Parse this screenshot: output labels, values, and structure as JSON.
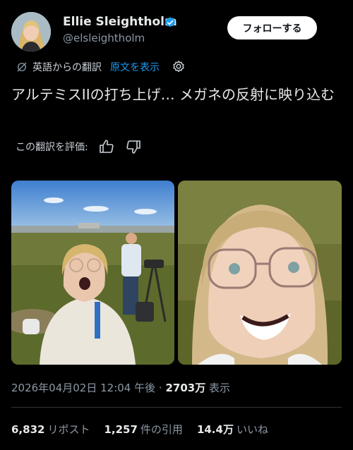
{
  "author": {
    "name": "Ellie Sleightholm",
    "handle": "@elsleightholm",
    "follow_label": "フォローする"
  },
  "translation": {
    "label": "英語からの翻訳",
    "show_original": "原文を表示",
    "rate_label": "この翻訳を評価:"
  },
  "tweet": {
    "text": "アルテミスIIの打ち上げ… メガネの反射に映り込む"
  },
  "meta": {
    "datetime": "2026年04月02日 12:04 午後",
    "views_count": "2703万",
    "views_label": "表示"
  },
  "stats": [
    {
      "count": "6,832",
      "label": "リポスト"
    },
    {
      "count": "1,257",
      "label": "件の引用"
    },
    {
      "count": "14.4万",
      "label": "いいね"
    }
  ],
  "colors": {
    "background": "#000000",
    "accent": "#1d9bf0",
    "secondary_text": "#8b98a5"
  },
  "icons": [
    "verified-badge-icon",
    "translate-icon",
    "gear-icon",
    "thumbs-up-icon",
    "thumbs-down-icon"
  ]
}
